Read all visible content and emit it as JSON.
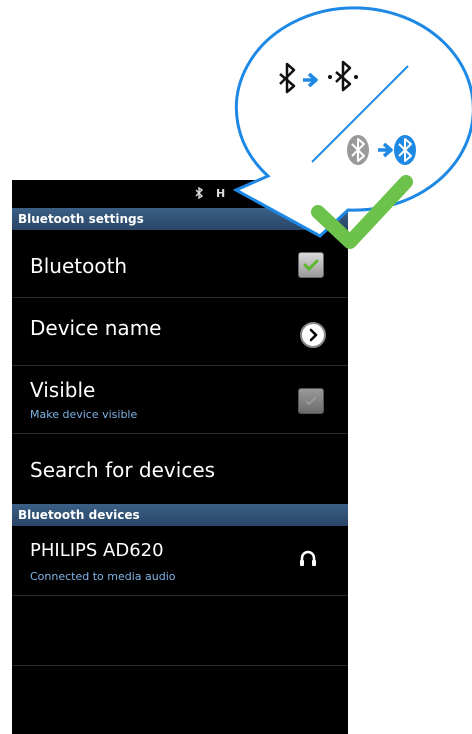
{
  "settings_header": "Bluetooth settings",
  "rows": {
    "bluetooth": {
      "title": "Bluetooth",
      "checked": true
    },
    "device_name": {
      "title": "Device name"
    },
    "visible": {
      "title": "Visible",
      "subtitle": "Make device visible",
      "checked": false
    },
    "search": {
      "title": "Search for devices"
    }
  },
  "devices_header": "Bluetooth devices",
  "devices": [
    {
      "name": "PHILIPS AD620",
      "status": "Connected to media audio",
      "icon": "headphones-icon"
    }
  ],
  "callout": {
    "icons": [
      "bluetooth-icon",
      "arrow-right-icon",
      "bluetooth-searching-icon",
      "bluetooth-grey-icon",
      "bluetooth-blue-icon",
      "checkmark-icon"
    ]
  },
  "colors": {
    "header_blue": "#3b5f86",
    "accent_blue": "#1e88e5",
    "check_green": "#6cc24a",
    "subtitle_blue": "#7fb3e6"
  }
}
